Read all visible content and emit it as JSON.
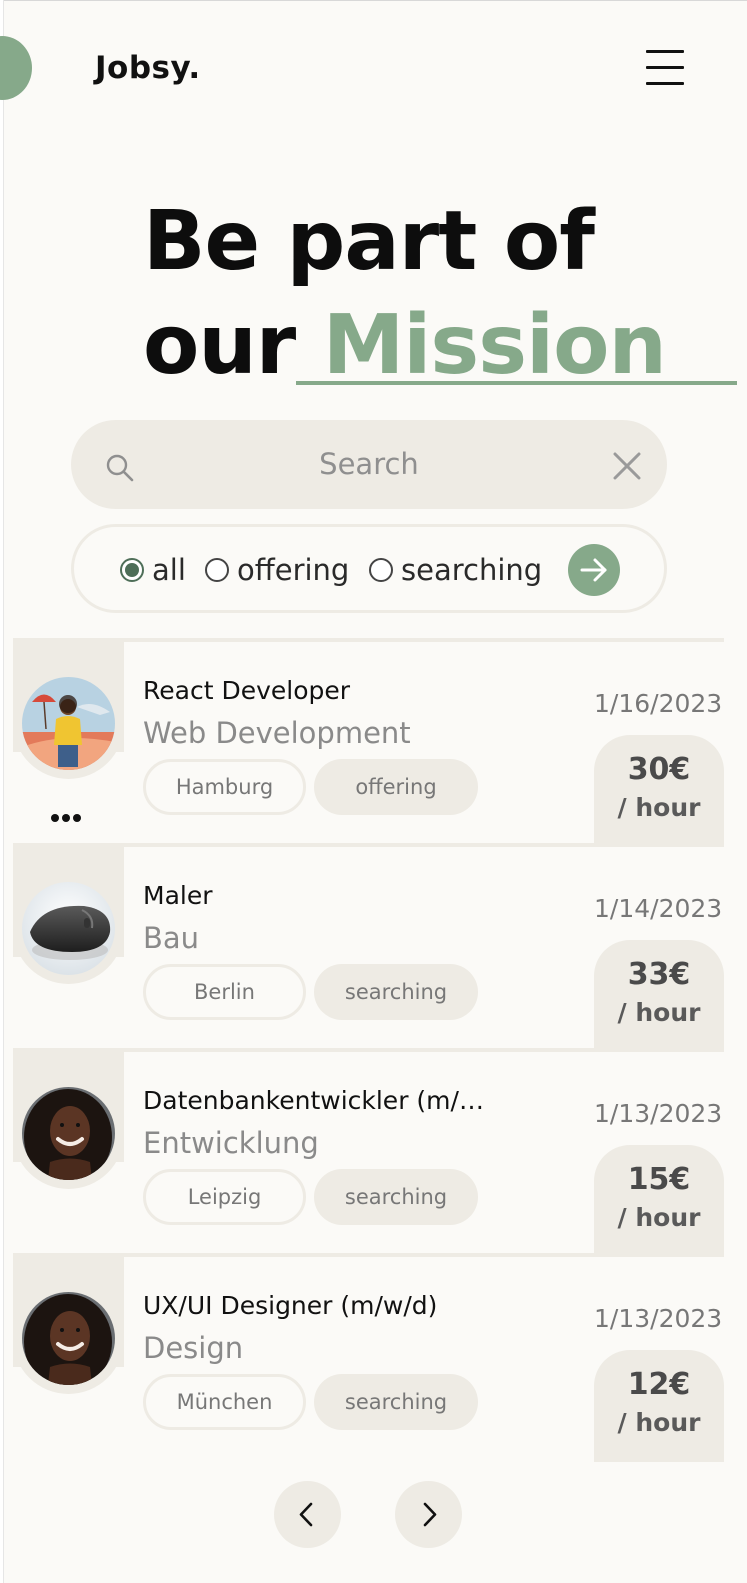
{
  "header": {
    "brand": "Jobsy.",
    "menu_icon": "hamburger-icon"
  },
  "hero": {
    "line1": "Be part of",
    "line2_prefix": "our ",
    "line2_accent": "Mission",
    "accent_color": "#86a98a"
  },
  "search": {
    "placeholder": "Search",
    "search_icon": "search-icon",
    "clear_icon": "close-icon"
  },
  "filters": {
    "options": [
      {
        "label": "all",
        "checked": true
      },
      {
        "label": "offering",
        "checked": false
      },
      {
        "label": "searching",
        "checked": false
      }
    ],
    "submit_icon": "arrow-right-icon"
  },
  "jobs": [
    {
      "title": "React Developer",
      "category": "Web Development",
      "location": "Hamburg",
      "type": "offering",
      "date": "1/16/2023",
      "price": "30€",
      "unit": "/ hour",
      "avatar": "woman-umbrella-photo",
      "has_more": true
    },
    {
      "title": "Maler",
      "category": "Bau",
      "location": "Berlin",
      "type": "searching",
      "date": "1/14/2023",
      "price": "33€",
      "unit": "/ hour",
      "avatar": "computer-mouse-photo",
      "has_more": false
    },
    {
      "title": "Datenbankentwickler (m/…",
      "category": "Entwicklung",
      "location": "Leipzig",
      "type": "searching",
      "date": "1/13/2023",
      "price": "15€",
      "unit": "/ hour",
      "avatar": "woman-portrait-photo",
      "has_more": false
    },
    {
      "title": "UX/UI Designer (m/w/d)",
      "category": "Design",
      "location": "München",
      "type": "searching",
      "date": "1/13/2023",
      "price": "12€",
      "unit": "/ hour",
      "avatar": "woman-portrait-photo",
      "has_more": false
    }
  ],
  "pagination": {
    "prev_icon": "chevron-left-icon",
    "next_icon": "chevron-right-icon"
  },
  "colors": {
    "background": "#fbfaf7",
    "surface": "#eeebe4",
    "accent": "#86a98a"
  }
}
